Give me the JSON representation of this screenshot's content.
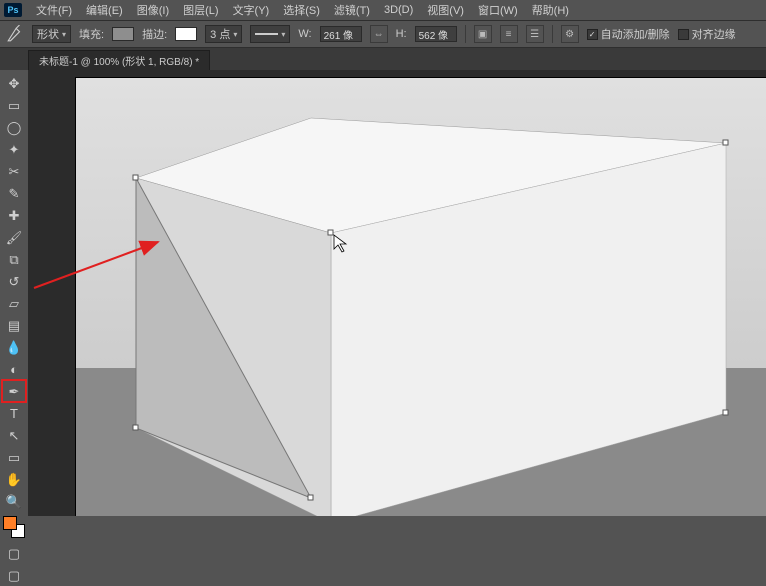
{
  "menu": {
    "items": [
      "文件(F)",
      "编辑(E)",
      "图像(I)",
      "图层(L)",
      "文字(Y)",
      "选择(S)",
      "滤镜(T)",
      "3D(D)",
      "视图(V)",
      "窗口(W)",
      "帮助(H)"
    ]
  },
  "optionsbar": {
    "mode_label": "形状",
    "fill_label": "填充:",
    "stroke_label": "描边:",
    "stroke_width": "3 点",
    "w_label": "W:",
    "w_value": "261 像",
    "h_label": "H:",
    "h_value": "562 像",
    "auto_check": "自动添加/删除",
    "align_check": "对齐边缘"
  },
  "doctab": {
    "title": "未标题-1 @ 100% (形状 1, RGB/8) *"
  },
  "tools": [
    {
      "name": "move-tool",
      "glyph": "✥"
    },
    {
      "name": "marquee-tool",
      "glyph": "▭"
    },
    {
      "name": "lasso-tool",
      "glyph": "◯"
    },
    {
      "name": "magic-wand-tool",
      "glyph": "✦"
    },
    {
      "name": "crop-tool",
      "glyph": "✂"
    },
    {
      "name": "eyedropper-tool",
      "glyph": "✎"
    },
    {
      "name": "spot-heal-tool",
      "glyph": "✚"
    },
    {
      "name": "brush-tool",
      "glyph": "🖌"
    },
    {
      "name": "stamp-tool",
      "glyph": "⧉"
    },
    {
      "name": "history-brush-tool",
      "glyph": "↺"
    },
    {
      "name": "eraser-tool",
      "glyph": "▱"
    },
    {
      "name": "gradient-tool",
      "glyph": "▤"
    },
    {
      "name": "blur-tool",
      "glyph": "💧"
    },
    {
      "name": "dodge-tool",
      "glyph": "◐"
    },
    {
      "name": "pen-tool",
      "glyph": "✒",
      "highlight": true
    },
    {
      "name": "type-tool",
      "glyph": "T"
    },
    {
      "name": "path-select-tool",
      "glyph": "↖"
    },
    {
      "name": "shape-tool",
      "glyph": "▭"
    },
    {
      "name": "hand-tool",
      "glyph": "✋"
    },
    {
      "name": "zoom-tool",
      "glyph": "🔍"
    }
  ],
  "colors": {
    "fg": "#ff7f27",
    "bg": "#ffffff",
    "fill_swatch": "#8e8e8e",
    "stroke_swatch": "#ffffff"
  }
}
